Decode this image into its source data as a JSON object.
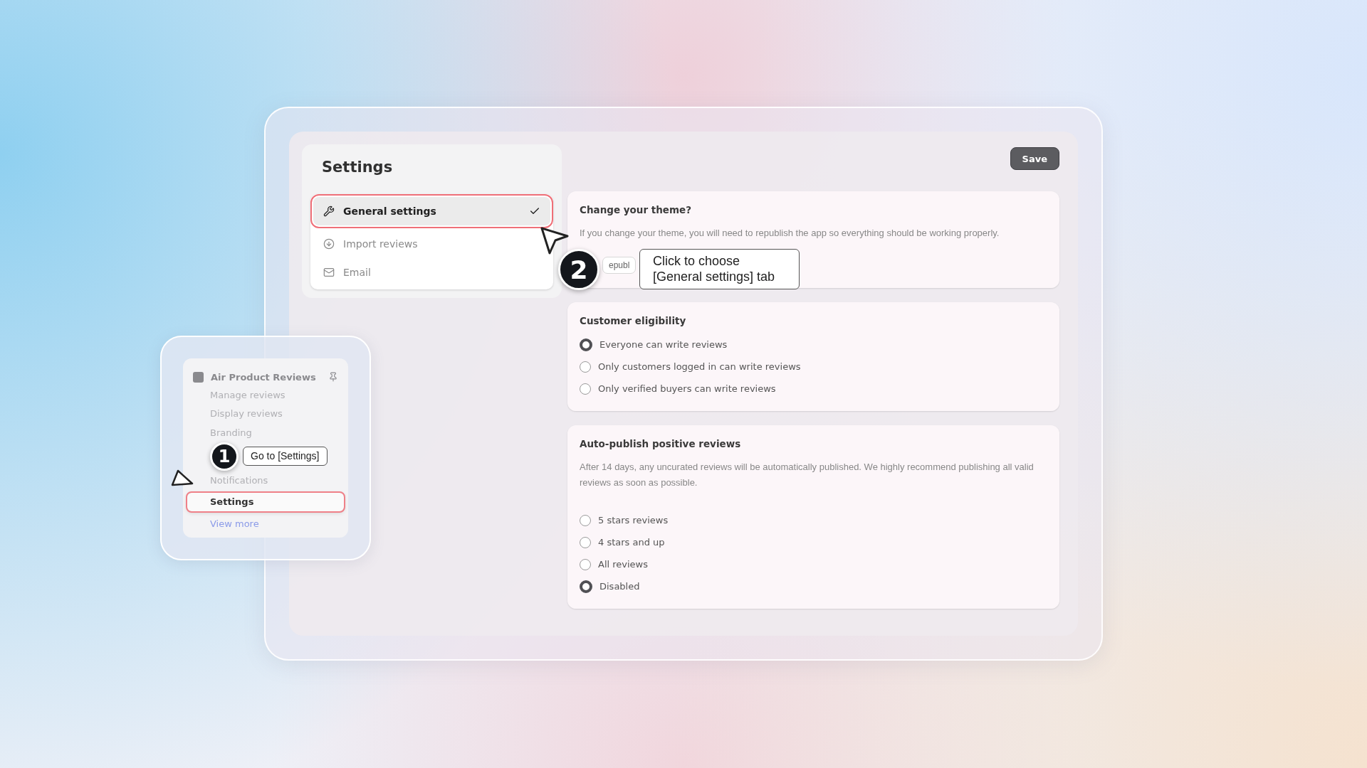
{
  "header": {
    "title": "Settings",
    "save_button": "Save"
  },
  "settings_nav": [
    {
      "label": "General settings",
      "selected": true
    },
    {
      "label": "Import reviews",
      "selected": false
    },
    {
      "label": "Email",
      "selected": false
    }
  ],
  "theme_card": {
    "title": "Change your theme?",
    "description": "If you change your theme, you will need to republish the app so everything should be working properly.",
    "button": "epubl"
  },
  "customer_eligibility": {
    "title": "Customer eligibility",
    "options": [
      {
        "label": "Everyone can write reviews",
        "selected": true
      },
      {
        "label": "Only customers logged in can write reviews",
        "selected": false
      },
      {
        "label": "Only verified buyers can write reviews",
        "selected": false
      }
    ]
  },
  "auto_publish": {
    "title": "Auto-publish positive reviews",
    "description": "After 14 days, any uncurated reviews will be automatically published. We highly recommend publishing all valid reviews as soon as possible.",
    "options": [
      {
        "label": "5 stars reviews",
        "selected": false
      },
      {
        "label": "4 stars and up",
        "selected": false
      },
      {
        "label": "All reviews",
        "selected": false
      },
      {
        "label": "Disabled",
        "selected": true
      }
    ]
  },
  "app_menu": {
    "title": "Air Product Reviews",
    "items": [
      {
        "label": "Manage reviews",
        "selected": false
      },
      {
        "label": "Display reviews",
        "selected": false
      },
      {
        "label": "Branding",
        "selected": false
      },
      {
        "label": "Notifications",
        "selected": false
      },
      {
        "label": "Settings",
        "selected": true
      }
    ],
    "view_more": "View more"
  },
  "steps": [
    {
      "number": "1",
      "text": "Go to [Settings]"
    },
    {
      "number": "2",
      "text": "Click to choose [General settings] tab"
    }
  ]
}
